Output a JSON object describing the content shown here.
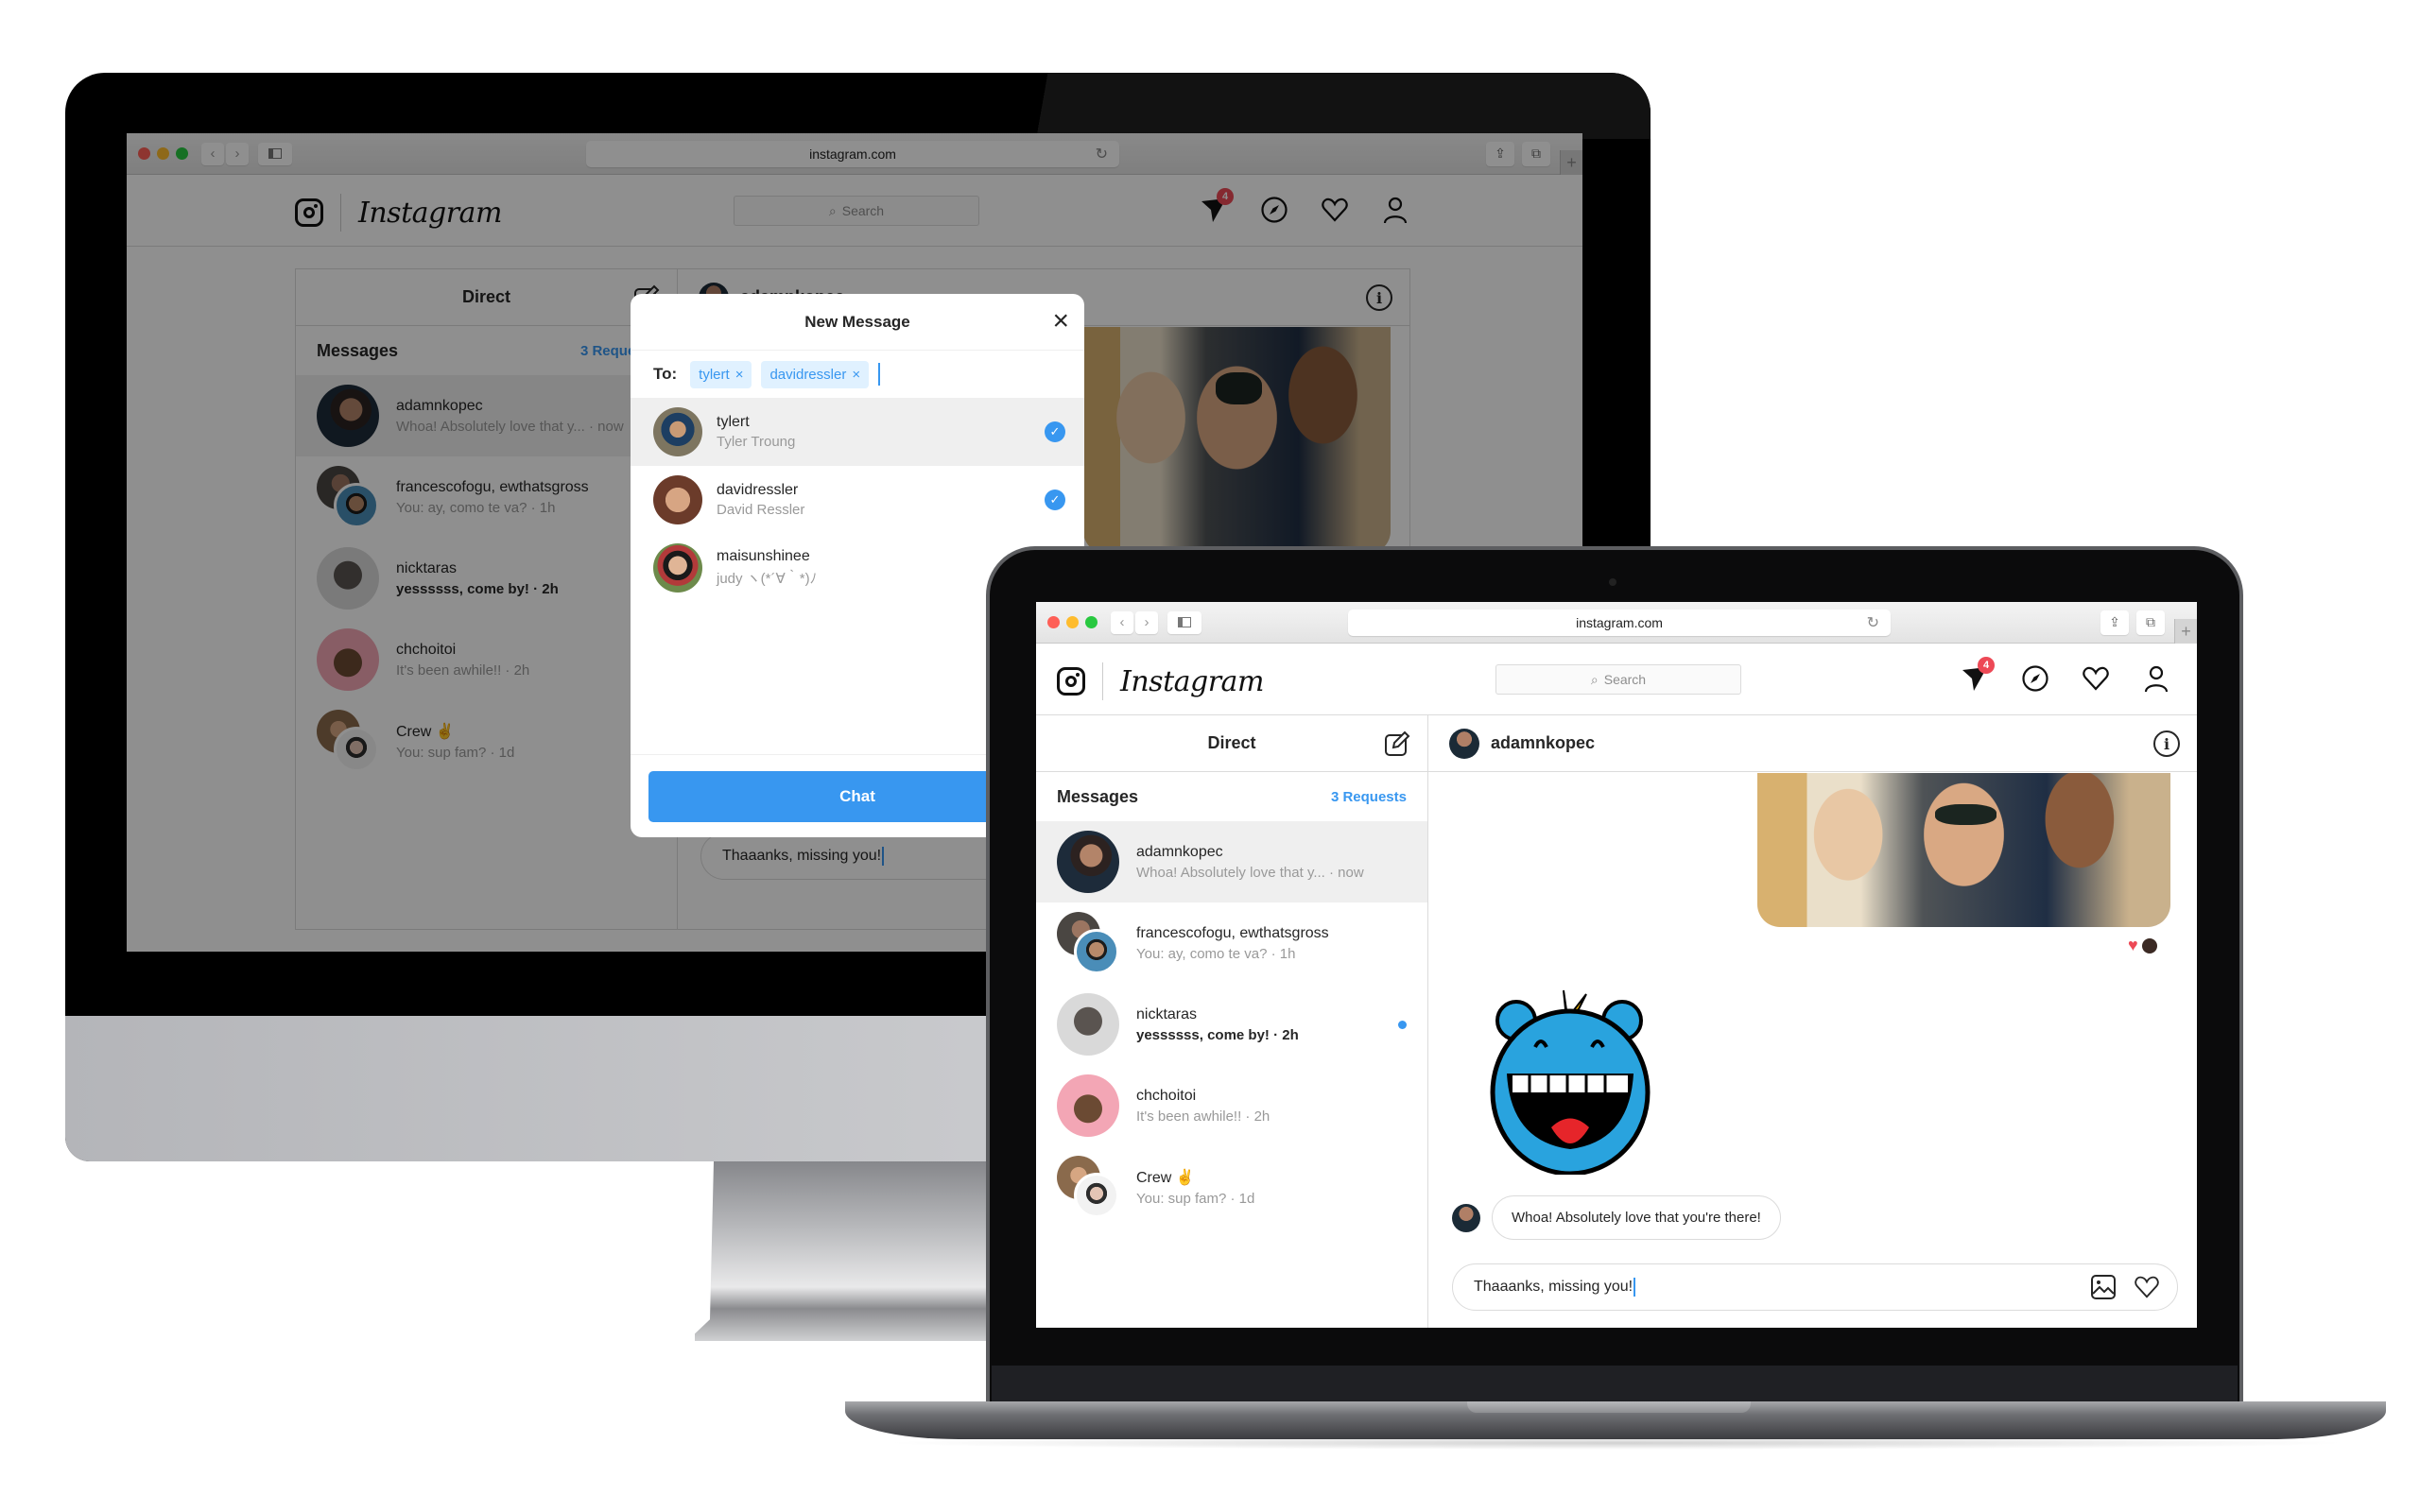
{
  "browser": {
    "url": "instagram.com",
    "back_icon": "‹",
    "forward_icon": "›",
    "reload_icon": "↻",
    "share_icon": "⇪",
    "tabs_icon": "⧉",
    "newtab_icon": "+"
  },
  "header": {
    "wordmark": "Instagram",
    "search_placeholder": "Search",
    "search_icon": "⌕",
    "direct_badge_count": "4",
    "icons": [
      "direct-icon",
      "explore-compass-icon",
      "activity-heart-icon",
      "profile-icon"
    ]
  },
  "direct": {
    "title": "Direct",
    "messages_label": "Messages",
    "requests_label": "3 Requests",
    "threads": [
      {
        "name": "adamnkopec",
        "preview": "Whoa! Absolutely love that y... · now",
        "active": true,
        "unread": false,
        "group": false
      },
      {
        "name": "francescofogu, ewthatsgross",
        "preview": "You: ay, como te va? · 1h",
        "active": false,
        "unread": false,
        "group": true
      },
      {
        "name": "nicktaras",
        "preview": "yessssss, come by! · 2h",
        "active": false,
        "unread": true,
        "group": false
      },
      {
        "name": "chchoitoi",
        "preview": "It's been awhile!! · 2h",
        "active": false,
        "unread": false,
        "group": false
      },
      {
        "name": "Crew ✌️",
        "preview": "You: sup fam? · 1d",
        "active": false,
        "unread": false,
        "group": true
      }
    ]
  },
  "chat": {
    "username": "adamnkopec",
    "reaction": "♥",
    "incoming_message": "Whoa! Absolutely love that you're there!",
    "composer_value": "Thaaanks, missing you!"
  },
  "new_message_modal": {
    "title": "New Message",
    "close_icon": "×",
    "to_label": "To:",
    "chips": [
      {
        "label": "tylert",
        "remove": "×"
      },
      {
        "label": "davidressler",
        "remove": "×"
      }
    ],
    "candidates": [
      {
        "username": "tylert",
        "fullname": "Tyler Troung",
        "selected": true
      },
      {
        "username": "davidressler",
        "fullname": "David Ressler",
        "selected": true
      },
      {
        "username": "maisunshinee",
        "fullname": "judy ヽ(*´∀｀*)ﾉ",
        "selected": false
      }
    ],
    "check_icon": "✓",
    "chat_button": "Chat"
  },
  "colors": {
    "accent_blue": "#3897f0",
    "badge_red": "#ed4956",
    "border": "#dbdbdb",
    "active_row": "#efefef"
  }
}
